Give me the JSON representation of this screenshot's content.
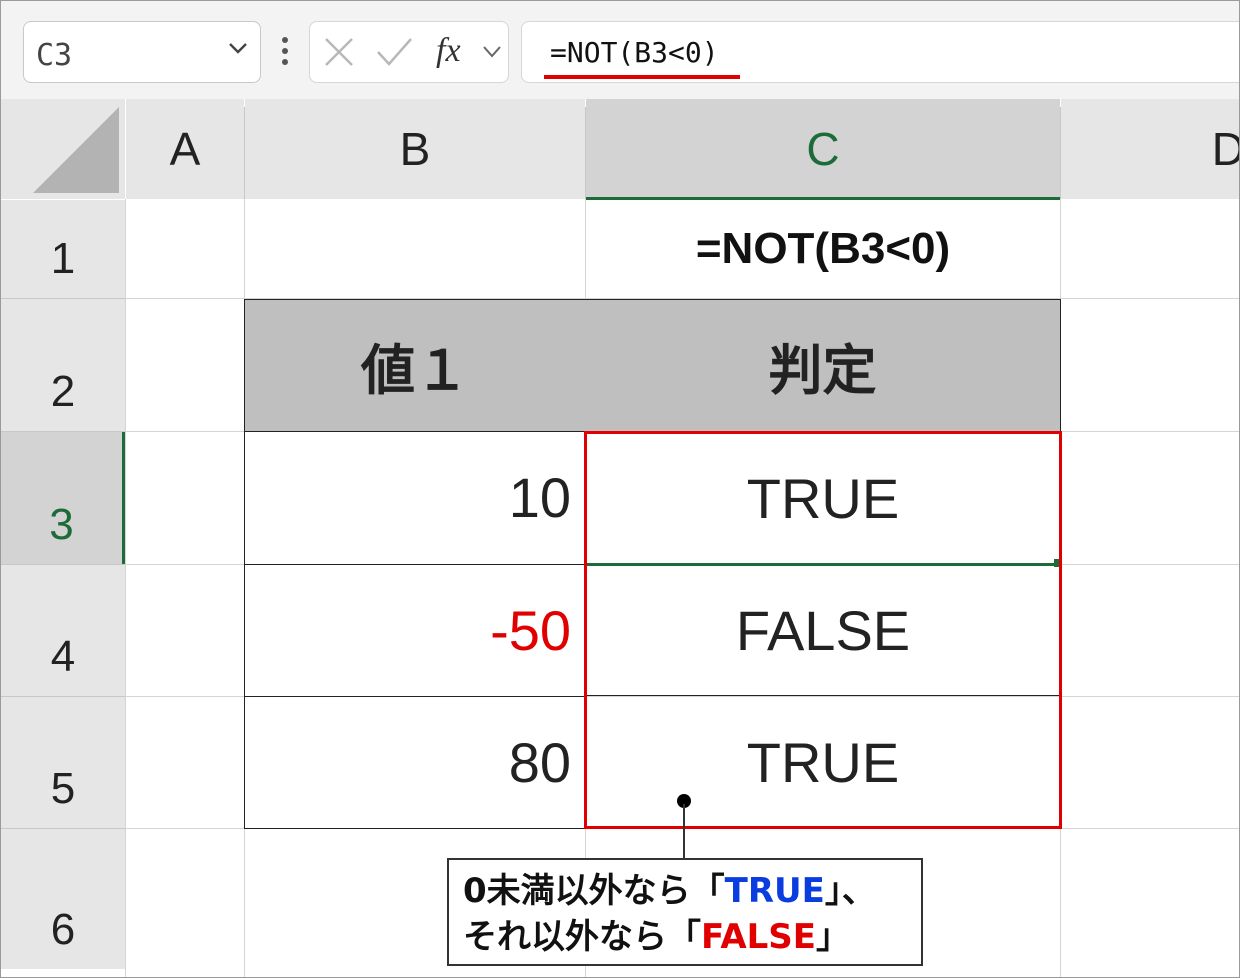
{
  "name_box": {
    "value": "C3"
  },
  "formula_bar": {
    "fx_label": "fx",
    "formula": "=NOT(B3<0)"
  },
  "columns": [
    "A",
    "B",
    "C",
    "D"
  ],
  "selected_column": "C",
  "rows": [
    "1",
    "2",
    "3",
    "4",
    "5",
    "6"
  ],
  "selected_row": "3",
  "sheet": {
    "c1_formula_display": "=NOT(B3<0)",
    "table_header": {
      "value_col": "値１",
      "result_col": "判定"
    },
    "values": [
      "10",
      "-50",
      "80"
    ],
    "results": [
      "TRUE",
      "FALSE",
      "TRUE"
    ]
  },
  "callout": {
    "line1_prefix": "0未満以外なら「",
    "line1_highlight": "TRUE",
    "line1_suffix": "」、",
    "line2_prefix": "それ以外なら「",
    "line2_highlight": "FALSE",
    "line2_suffix": "」"
  },
  "colors": {
    "accent_green": "#1e6b3a",
    "highlight_red": "#e00000",
    "highlight_blue": "#0a3de0"
  }
}
